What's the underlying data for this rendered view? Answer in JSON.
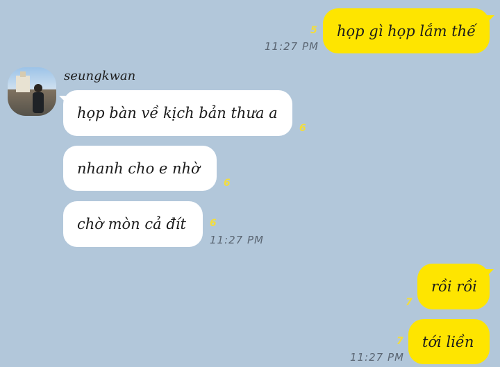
{
  "contact": {
    "name": "seungkwan"
  },
  "messages": [
    {
      "text": "họp gì họp lắm thế",
      "unread": "5",
      "time": "11:27 PM"
    },
    {
      "text": "họp bàn về kịch bản thưa a",
      "unread": "6"
    },
    {
      "text": "nhanh cho e nhờ",
      "unread": "6"
    },
    {
      "text": "chờ mòn cả đít",
      "unread": "6",
      "time": "11:27 PM"
    },
    {
      "text": "rồi rồi",
      "unread": "7"
    },
    {
      "text": "tới liền",
      "unread": "7",
      "time": "11:27 PM"
    }
  ],
  "colors": {
    "background": "#b2c7da",
    "my_bubble": "#fee500",
    "their_bubble": "#ffffff",
    "unread": "#f3dd3c"
  },
  "icons": {
    "avatar": "profile-photo"
  }
}
